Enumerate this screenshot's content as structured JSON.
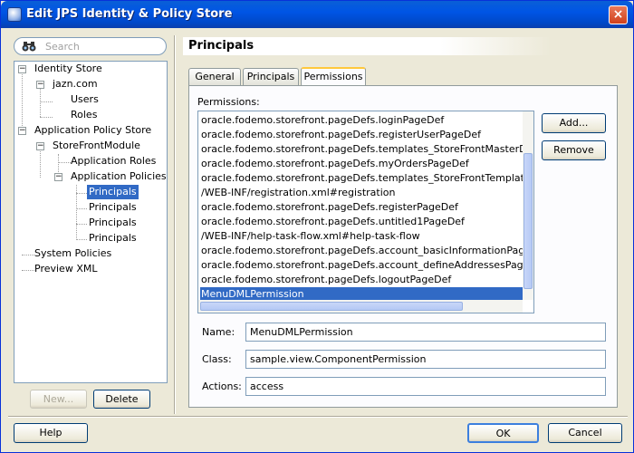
{
  "window": {
    "title": "Edit JPS Identity & Policy Store",
    "close": "×"
  },
  "search": {
    "placeholder": "Search"
  },
  "tree": {
    "identity_store": "Identity Store",
    "jazn": "jazn.com",
    "users": "Users",
    "roles": "Roles",
    "app_policy_store": "Application Policy Store",
    "storefront": "StoreFrontModule",
    "app_roles": "Application Roles",
    "app_policies": "Application Policies",
    "principals": [
      "Principals",
      "Principals",
      "Principals",
      "Principals"
    ],
    "system_policies": "System Policies",
    "preview_xml": "Preview XML",
    "expand_minus": "−"
  },
  "left_buttons": {
    "new": "New...",
    "delete": "Delete"
  },
  "panel": {
    "title": "Principals"
  },
  "tabs": [
    "General",
    "Principals",
    "Permissions"
  ],
  "permissions": {
    "label": "Permissions:",
    "items": [
      "oracle.fodemo.storefront.pageDefs.loginPageDef",
      "oracle.fodemo.storefront.pageDefs.registerUserPageDef",
      "oracle.fodemo.storefront.pageDefs.templates_StoreFrontMasterDetailTemplatePageDef",
      "oracle.fodemo.storefront.pageDefs.myOrdersPageDef",
      "oracle.fodemo.storefront.pageDefs.templates_StoreFrontTemplatePageDef",
      "/WEB-INF/registration.xml#registration",
      "oracle.fodemo.storefront.pageDefs.registerPageDef",
      "oracle.fodemo.storefront.pageDefs.untitled1PageDef",
      "/WEB-INF/help-task-flow.xml#help-task-flow",
      "oracle.fodemo.storefront.pageDefs.account_basicInformationPageDef",
      "oracle.fodemo.storefront.pageDefs.account_defineAddressesPageDef",
      "oracle.fodemo.storefront.pageDefs.logoutPageDef",
      "MenuDMLPermission"
    ],
    "add": "Add...",
    "remove": "Remove"
  },
  "fields": {
    "name_label": "Name:",
    "name_value": "MenuDMLPermission",
    "class_label": "Class:",
    "class_value": "sample.view.ComponentPermission",
    "actions_label": "Actions:",
    "actions_value": "access"
  },
  "footer": {
    "help": "Help",
    "ok": "OK",
    "cancel": "Cancel"
  }
}
